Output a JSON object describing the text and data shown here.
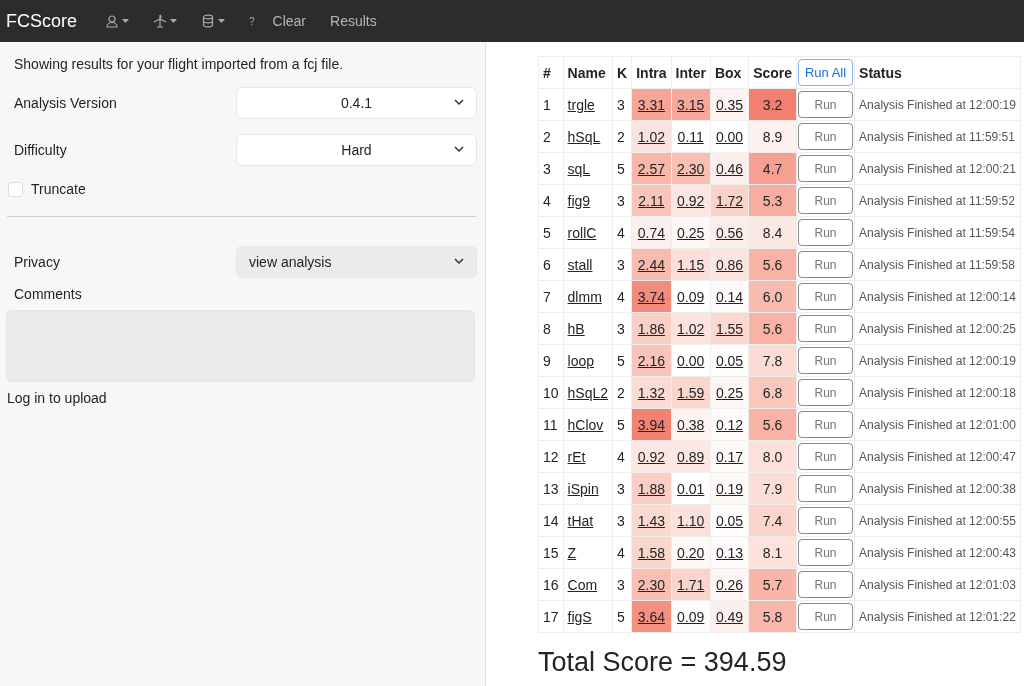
{
  "navbar": {
    "brand": "FCScore",
    "menus": [
      {
        "kind": "user"
      },
      {
        "kind": "plane"
      },
      {
        "kind": "database"
      }
    ],
    "help": "?",
    "links": [
      "Clear",
      "Results"
    ]
  },
  "form": {
    "intro": "Showing results for your flight imported from a fcj file.",
    "selects": [
      {
        "label": "Analysis Version",
        "value": "0.4.1",
        "kind": "centered"
      },
      {
        "label": "Difficulty",
        "value": "Hard",
        "kind": "centered"
      }
    ],
    "truncate": {
      "label": "Truncate",
      "checked": false
    },
    "privacy": {
      "label": "Privacy",
      "value": "view analysis"
    },
    "comments": {
      "label": "Comments"
    },
    "login": "Log in to upload"
  },
  "table": {
    "columns": [
      "#",
      "Name",
      "K",
      "Intra",
      "Inter",
      "Box",
      "Score",
      "Run All",
      "Status"
    ],
    "rows": [
      {
        "n": "1",
        "name": "trgle",
        "k": "3",
        "intra": {
          "text": "3.31",
          "color": "#f6a495"
        },
        "inter": {
          "text": "3.15",
          "color": "#f6a99b"
        },
        "box": {
          "text": "0.35",
          "color": "#fdf4f1"
        },
        "score": {
          "text": "3.2",
          "color": "#f27f70"
        },
        "run": "Run",
        "status": "Analysis Finished at 12:00:19"
      },
      {
        "n": "2",
        "name": "hSqL",
        "k": "2",
        "intra": {
          "text": "1.02",
          "color": "#fbe3dd"
        },
        "inter": {
          "text": "0.11",
          "color": "#ffffff"
        },
        "box": {
          "text": "0.00",
          "color": "#ffffff"
        },
        "score": {
          "text": "8.9",
          "color": "#fdf1ed"
        },
        "run": "Run",
        "status": "Analysis Finished at 11:59:51"
      },
      {
        "n": "3",
        "name": "sqL",
        "k": "5",
        "intra": {
          "text": "2.57",
          "color": "#f8b7aa"
        },
        "inter": {
          "text": "2.30",
          "color": "#f9bfb3"
        },
        "box": {
          "text": "0.46",
          "color": "#fdf0ec"
        },
        "score": {
          "text": "4.7",
          "color": "#f6a092"
        },
        "run": "Run",
        "status": "Analysis Finished at 12:00:21"
      },
      {
        "n": "4",
        "name": "fig9",
        "k": "3",
        "intra": {
          "text": "2.11",
          "color": "#f9c5ba"
        },
        "inter": {
          "text": "0.92",
          "color": "#fce6e0"
        },
        "box": {
          "text": "1.72",
          "color": "#fad2c9"
        },
        "score": {
          "text": "5.3",
          "color": "#f7ad9f"
        },
        "run": "Run",
        "status": "Analysis Finished at 11:59:52"
      },
      {
        "n": "5",
        "name": "rollC",
        "k": "4",
        "intra": {
          "text": "0.74",
          "color": "#fdefeb"
        },
        "inter": {
          "text": "0.25",
          "color": "#fef7f5"
        },
        "box": {
          "text": "0.56",
          "color": "#fdede8"
        },
        "score": {
          "text": "8.4",
          "color": "#fce8e3"
        },
        "run": "Run",
        "status": "Analysis Finished at 11:59:54"
      },
      {
        "n": "6",
        "name": "stall",
        "k": "3",
        "intra": {
          "text": "2.44",
          "color": "#f8bbaf"
        },
        "inter": {
          "text": "1.15",
          "color": "#fcdfd8"
        },
        "box": {
          "text": "0.86",
          "color": "#fce5df"
        },
        "score": {
          "text": "5.6",
          "color": "#f8b3a6"
        },
        "run": "Run",
        "status": "Analysis Finished at 11:59:58"
      },
      {
        "n": "7",
        "name": "dlmm",
        "k": "4",
        "intra": {
          "text": "3.74",
          "color": "#f38b7c"
        },
        "inter": {
          "text": "0.09",
          "color": "#ffffff"
        },
        "box": {
          "text": "0.14",
          "color": "#fefaf9"
        },
        "score": {
          "text": "6.0",
          "color": "#f8bbaf"
        },
        "run": "Run",
        "status": "Analysis Finished at 12:00:14"
      },
      {
        "n": "8",
        "name": "hB",
        "k": "3",
        "intra": {
          "text": "1.86",
          "color": "#fad0c6"
        },
        "inter": {
          "text": "1.02",
          "color": "#fce3dc"
        },
        "box": {
          "text": "1.55",
          "color": "#fbd7ce"
        },
        "score": {
          "text": "5.6",
          "color": "#f8b3a6"
        },
        "run": "Run",
        "status": "Analysis Finished at 12:00:25"
      },
      {
        "n": "9",
        "name": "loop",
        "k": "5",
        "intra": {
          "text": "2.16",
          "color": "#f9c4b9"
        },
        "inter": {
          "text": "0.00",
          "color": "#ffffff"
        },
        "box": {
          "text": "0.05",
          "color": "#fffdfc"
        },
        "score": {
          "text": "7.8",
          "color": "#fbdcd4"
        },
        "run": "Run",
        "status": "Analysis Finished at 12:00:19"
      },
      {
        "n": "10",
        "name": "hSqL2",
        "k": "2",
        "intra": {
          "text": "1.32",
          "color": "#fbdcd4"
        },
        "inter": {
          "text": "1.59",
          "color": "#fbd6cd"
        },
        "box": {
          "text": "0.25",
          "color": "#fef7f5"
        },
        "score": {
          "text": "6.8",
          "color": "#f9c7bc"
        },
        "run": "Run",
        "status": "Analysis Finished at 12:00:18"
      },
      {
        "n": "11",
        "name": "hClov",
        "k": "5",
        "intra": {
          "text": "3.94",
          "color": "#f28272"
        },
        "inter": {
          "text": "0.38",
          "color": "#fdf3f0"
        },
        "box": {
          "text": "0.12",
          "color": "#fefbfa"
        },
        "score": {
          "text": "5.6",
          "color": "#f8b3a6"
        },
        "run": "Run",
        "status": "Analysis Finished at 12:01:00"
      },
      {
        "n": "12",
        "name": "rEt",
        "k": "4",
        "intra": {
          "text": "0.92",
          "color": "#fce6e0"
        },
        "inter": {
          "text": "0.89",
          "color": "#fce7e2"
        },
        "box": {
          "text": "0.17",
          "color": "#fefaf8"
        },
        "score": {
          "text": "8.0",
          "color": "#fce0d9"
        },
        "run": "Run",
        "status": "Analysis Finished at 12:00:47"
      },
      {
        "n": "13",
        "name": "iSpin",
        "k": "3",
        "intra": {
          "text": "1.88",
          "color": "#facec5"
        },
        "inter": {
          "text": "0.01",
          "color": "#ffffff"
        },
        "box": {
          "text": "0.19",
          "color": "#fef9f7"
        },
        "score": {
          "text": "7.9",
          "color": "#fbdfd7"
        },
        "run": "Run",
        "status": "Analysis Finished at 12:00:38"
      },
      {
        "n": "14",
        "name": "tHat",
        "k": "3",
        "intra": {
          "text": "1.43",
          "color": "#fbd8d0"
        },
        "inter": {
          "text": "1.10",
          "color": "#fce1da"
        },
        "box": {
          "text": "0.05",
          "color": "#fffdfc"
        },
        "score": {
          "text": "7.4",
          "color": "#fbd5cc"
        },
        "run": "Run",
        "status": "Analysis Finished at 12:00:55"
      },
      {
        "n": "15",
        "name": "Z",
        "k": "4",
        "intra": {
          "text": "1.58",
          "color": "#fad5cc"
        },
        "inter": {
          "text": "0.20",
          "color": "#fef8f6"
        },
        "box": {
          "text": "0.13",
          "color": "#fefbfa"
        },
        "score": {
          "text": "8.1",
          "color": "#fce2db"
        },
        "run": "Run",
        "status": "Analysis Finished at 12:00:43"
      },
      {
        "n": "16",
        "name": "Com",
        "k": "3",
        "intra": {
          "text": "2.30",
          "color": "#f9bfb3"
        },
        "inter": {
          "text": "1.71",
          "color": "#fad3ca"
        },
        "box": {
          "text": "0.26",
          "color": "#fef7f5"
        },
        "score": {
          "text": "5.7",
          "color": "#f8b5a8"
        },
        "run": "Run",
        "status": "Analysis Finished at 12:01:03"
      },
      {
        "n": "17",
        "name": "figS",
        "k": "5",
        "intra": {
          "text": "3.64",
          "color": "#f4907f"
        },
        "inter": {
          "text": "0.09",
          "color": "#fefcfb"
        },
        "box": {
          "text": "0.49",
          "color": "#fdefeb"
        },
        "score": {
          "text": "5.8",
          "color": "#f8b7aa"
        },
        "run": "Run",
        "status": "Analysis Finished at 12:01:22"
      }
    ]
  },
  "total": "Total Score = 394.59"
}
